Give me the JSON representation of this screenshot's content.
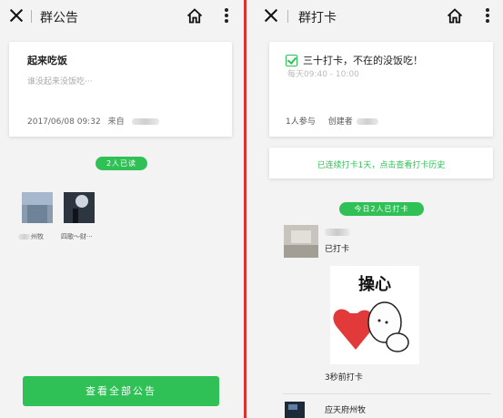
{
  "left": {
    "title": "群公告",
    "announcement": {
      "title": "起来吃饭",
      "body": "谁没起来没饭吃···",
      "datetime": "2017/06/08 09:32",
      "from_label": "来自"
    },
    "read_badge": "2人已读",
    "readers": [
      {
        "name": "州牧"
      },
      {
        "name": "四歌～财···"
      }
    ],
    "view_all_button": "查看全部公告"
  },
  "right": {
    "title": "群打卡",
    "checkin": {
      "title": "三十打卡，不在的没饭吃！",
      "schedule": "每天09:40 - 10:00",
      "participants": "1人参与",
      "creator_label": "创建者"
    },
    "history_link": "已连续打卡1天，点击查看打卡历史",
    "today_badge": "今日2人已打卡",
    "entries": [
      {
        "status": "已打卡",
        "sticker_text": "操心",
        "time": "3秒前打卡"
      },
      {
        "name": "应天府州牧"
      }
    ]
  },
  "colors": {
    "accent": "#2fc156",
    "divider": "#d9342b"
  }
}
